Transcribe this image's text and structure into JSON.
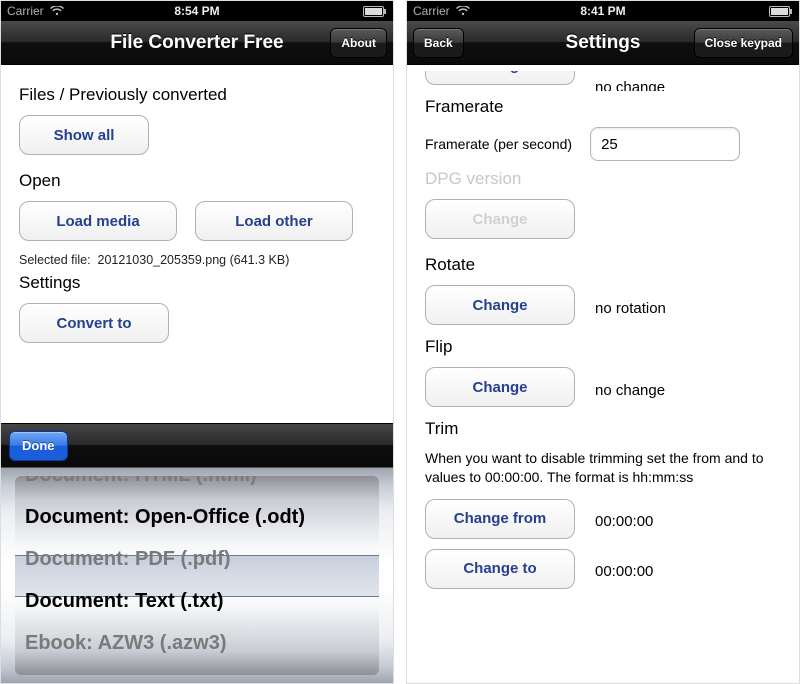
{
  "left": {
    "status": {
      "carrier": "Carrier",
      "time": "8:54 PM"
    },
    "nav": {
      "title": "File Converter Free",
      "about": "About"
    },
    "sections": {
      "files_heading": "Files / Previously converted",
      "show_all": "Show all",
      "open_heading": "Open",
      "load_media": "Load media",
      "load_other": "Load other",
      "selected_prefix": "Selected file:",
      "selected_value": "20121030_205359.png (641.3 KB)",
      "settings_heading": "Settings",
      "convert_to": "Convert to"
    },
    "toolbar": {
      "done": "Done"
    },
    "picker": {
      "items": [
        "Document: HTML (.html)",
        "Document: Open-Office (.odt)",
        "Document: PDF (.pdf)",
        "Document: Text (.txt)",
        "Ebook: AZW3 (.azw3)"
      ]
    }
  },
  "right": {
    "status": {
      "carrier": "Carrier",
      "time": "8:41 PM"
    },
    "nav": {
      "back": "Back",
      "title": "Settings",
      "close": "Close keypad"
    },
    "top_partial": {
      "change": "Change",
      "value": "no change"
    },
    "framerate": {
      "heading": "Framerate",
      "label": "Framerate (per second)",
      "value": "25"
    },
    "dpg": {
      "heading": "DPG version",
      "change": "Change"
    },
    "rotate": {
      "heading": "Rotate",
      "change": "Change",
      "value": "no rotation"
    },
    "flip": {
      "heading": "Flip",
      "change": "Change",
      "value": "no change"
    },
    "trim": {
      "heading": "Trim",
      "help": "When you want to disable trimming set the from and to values to 00:00:00. The format is hh:mm:ss",
      "from_btn": "Change from",
      "from_val": "00:00:00",
      "to_btn": "Change to",
      "to_val": "00:00:00"
    }
  }
}
